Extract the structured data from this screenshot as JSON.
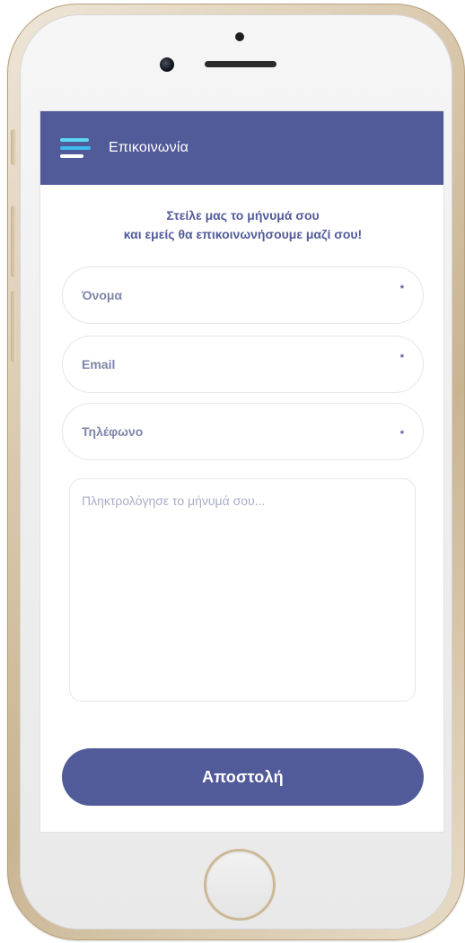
{
  "header": {
    "title": "Επικοινωνία",
    "menu_icon": "hamburger-menu-icon"
  },
  "intro": {
    "line1": "Στείλε μας το μήνυμά σου",
    "line2": "και εμείς θα επικοινωνήσουμε μαζί σου!"
  },
  "form": {
    "name": {
      "placeholder": "Όνομα",
      "required_mark": "*"
    },
    "email": {
      "placeholder": "Email",
      "required_mark": "*"
    },
    "phone": {
      "placeholder": "Τηλέφωνο",
      "required_mark": "*"
    },
    "message": {
      "placeholder": "Πληκτρολόγησε το μήνυμά σου..."
    },
    "submit_label": "Αποστολή"
  },
  "colors": {
    "brand": "#525b99",
    "accent_cyan": "#5ed7f4",
    "accent_blue": "#3fb8ee",
    "placeholder": "#7e84a8"
  }
}
